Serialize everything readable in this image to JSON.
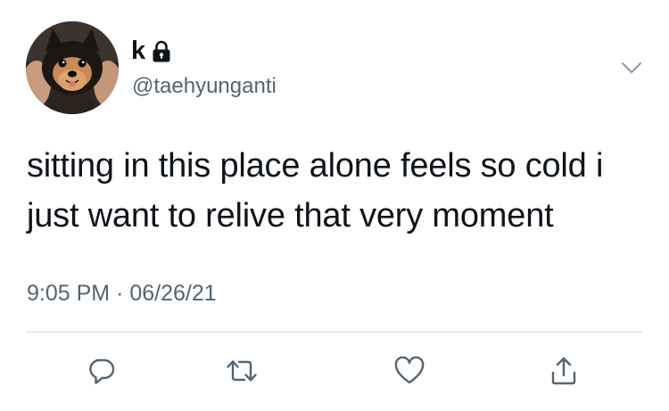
{
  "author": {
    "display_name": "k",
    "username": "@taehyunganti",
    "protected_account_icon": "lock-icon",
    "avatar_icon": "avatar-dog-photo"
  },
  "tweet": {
    "text": "sitting in this place alone feels so cold i just want to relive that very moment",
    "time": "9:05 PM",
    "separator": "·",
    "date": "06/26/21"
  },
  "actions": [
    {
      "name": "reply",
      "icon": "reply-icon"
    },
    {
      "name": "retweet",
      "icon": "retweet-icon"
    },
    {
      "name": "like",
      "icon": "heart-icon"
    },
    {
      "name": "share",
      "icon": "share-icon"
    }
  ],
  "menu": {
    "icon": "chevron-down-icon"
  },
  "colors": {
    "text": "#0f1419",
    "secondary_text": "#536471",
    "icon": "#536471",
    "divider": "#cfd9de",
    "background": "#ffffff"
  }
}
